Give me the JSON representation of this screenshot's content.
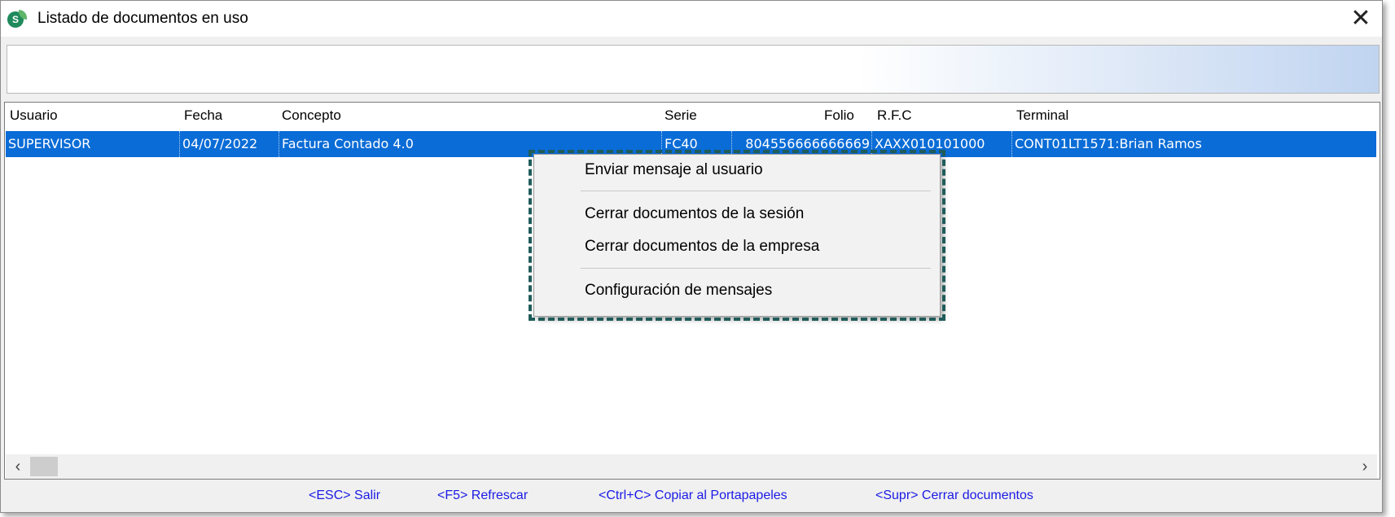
{
  "window": {
    "title": "Listado de documentos en uso",
    "app_icon_letter": "S",
    "close_glyph": "✕"
  },
  "grid": {
    "columns": [
      "Usuario",
      "Fecha",
      "Concepto",
      "Serie",
      "Folio",
      "R.F.C",
      "Terminal"
    ],
    "rows": [
      [
        "SUPERVISOR",
        "04/07/2022",
        "Factura Contado 4.0",
        "FC40",
        "804556666666669",
        "XAXX010101000",
        "CONT01LT1571:Brian Ramos"
      ]
    ]
  },
  "scrollbar": {
    "left_glyph": "‹",
    "right_glyph": "›"
  },
  "hotkeys": [
    "<ESC> Salir",
    "<F5> Refrescar",
    "<Ctrl+C> Copiar al Portapapeles",
    "<Supr> Cerrar documentos"
  ],
  "context_menu": {
    "items": [
      "Enviar mensaje al usuario",
      "Cerrar documentos de la sesión",
      "Cerrar documentos de la empresa",
      "Configuración de mensajes"
    ]
  },
  "colors": {
    "selection": "#0a6cd6",
    "hotkey": "#1a1ae6",
    "highlight_border": "#1f5c5a"
  }
}
